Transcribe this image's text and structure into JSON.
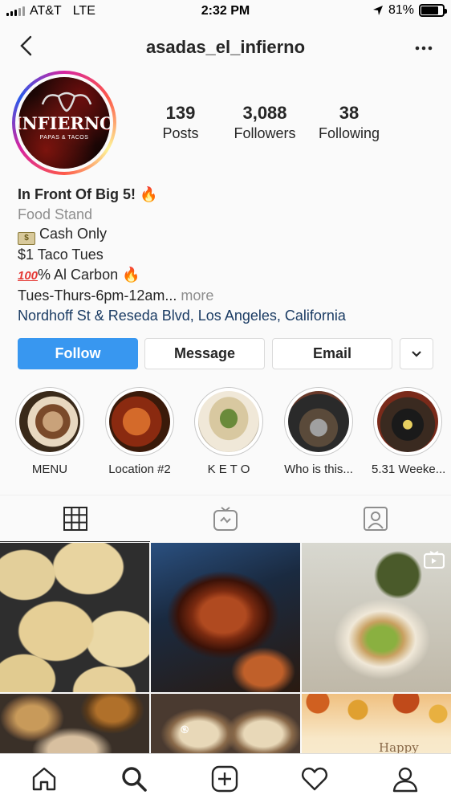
{
  "status_bar": {
    "carrier": "AT&T",
    "network": "LTE",
    "time": "2:32 PM",
    "battery": "81%",
    "battery_level": 0.81,
    "icons": [
      "signal-icon",
      "location-arrow-icon",
      "battery-icon"
    ]
  },
  "header": {
    "username": "asadas_el_infierno",
    "back_icon": "chevron-left-icon",
    "more_icon": "ellipsis-icon"
  },
  "profile": {
    "avatar_logo_text": "INFIERNO",
    "avatar_logo_subtext": "PAPAS & TACOS",
    "stats": [
      {
        "value": "139",
        "label": "Posts"
      },
      {
        "value": "3,088",
        "label": "Followers"
      },
      {
        "value": "38",
        "label": "Following"
      }
    ]
  },
  "bio": {
    "name": "In Front Of Big 5! 🔥",
    "category": "Food Stand",
    "lines": [
      "Cash Only",
      "$1 Taco Tues",
      "% Al Carbon 🔥",
      "Tues-Thurs-6pm-12am..."
    ],
    "cash_emoji_text": "$",
    "hundred_emoji_text": "100",
    "more": " more",
    "address": "Nordhoff St & Reseda Blvd, Los Angeles, California"
  },
  "actions": {
    "follow": "Follow",
    "message": "Message",
    "email": "Email",
    "dropdown_icon": "chevron-down-icon"
  },
  "highlights": [
    {
      "label": "MENU"
    },
    {
      "label": "Location #2"
    },
    {
      "label": "K E T O"
    },
    {
      "label": "Who is this..."
    },
    {
      "label": "5.31 Weeke..."
    }
  ],
  "tabs": [
    {
      "name": "grid",
      "icon": "grid-icon",
      "active": true
    },
    {
      "name": "igtv",
      "icon": "igtv-icon",
      "active": false
    },
    {
      "name": "tagged",
      "icon": "tagged-user-icon",
      "active": false
    }
  ],
  "grid": {
    "watermark": "®",
    "happy_text": "Happy",
    "igtv_badge_icon": "igtv-badge-icon"
  },
  "nav": [
    "home-icon",
    "search-icon",
    "new-post-icon",
    "activity-heart-icon",
    "profile-icon"
  ]
}
